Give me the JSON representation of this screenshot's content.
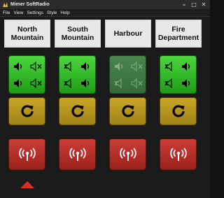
{
  "window": {
    "title": "Mimer SoftRadio",
    "minimize_glyph": "–",
    "maximize_glyph": "□",
    "close_glyph": "✕"
  },
  "menu": [
    "File",
    "View",
    "Settings",
    "Style",
    "Help"
  ],
  "channels": [
    {
      "line1": "North",
      "line2": "Mountain",
      "selected": true
    },
    {
      "line1": "South",
      "line2": "Mountain",
      "selected": false
    },
    {
      "line1": "Harbour",
      "line2": "",
      "selected": false
    },
    {
      "line1": "Fire",
      "line2": "Department",
      "selected": false
    }
  ],
  "colors": {
    "audio_active": "#2ec026",
    "audio_inactive": "#4a8a4e",
    "reset": "#b8961f",
    "radio": "#b32e29",
    "ptt_indicator": "#d3302a"
  },
  "icons": {
    "speaker_on": "speaker-icon",
    "speaker_muted": "speaker-muted-icon",
    "reset": "refresh-icon",
    "radio": "radio-transmit-icon"
  }
}
